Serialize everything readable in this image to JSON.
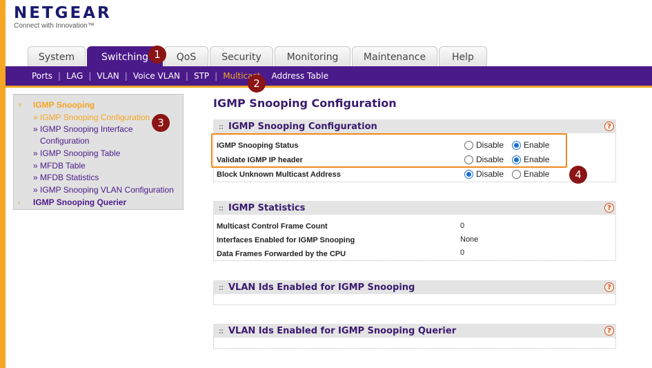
{
  "brand": {
    "name": "NETGEAR",
    "tagline": "Connect with Innovation™"
  },
  "tabs": [
    {
      "label": "System"
    },
    {
      "label": "Switching",
      "active": true
    },
    {
      "label": "QoS"
    },
    {
      "label": "Security"
    },
    {
      "label": "Monitoring"
    },
    {
      "label": "Maintenance"
    },
    {
      "label": "Help"
    }
  ],
  "subnav": [
    {
      "label": "Ports"
    },
    {
      "label": "LAG"
    },
    {
      "label": "VLAN"
    },
    {
      "label": "Voice VLAN"
    },
    {
      "label": "STP"
    },
    {
      "label": "Multicast",
      "active": true
    },
    {
      "label": "Address Table"
    }
  ],
  "sidebar": {
    "section1": "IGMP Snooping",
    "links": [
      "» IGMP Snooping Configuration",
      "» IGMP Snooping Interface",
      "Configuration",
      "» IGMP Snooping Table",
      "» MFDB Table",
      "» MFDB Statistics",
      "» IGMP Snooping VLAN Configuration"
    ],
    "section2": "IGMP Snooping Querier"
  },
  "page_title": "IGMP Snooping Configuration",
  "config_panel": {
    "title": "IGMP Snooping Configuration",
    "rows": [
      {
        "label": "IGMP Snooping Status",
        "selected": "Enable"
      },
      {
        "label": "Validate IGMP IP header",
        "selected": "Enable"
      },
      {
        "label": "Block Unknown Multicast Address",
        "selected": "Disable"
      }
    ],
    "option_disable": "Disable",
    "option_enable": "Enable"
  },
  "stats_panel": {
    "title": "IGMP Statistics",
    "rows": [
      {
        "label": "Multicast Control Frame Count",
        "value": "0"
      },
      {
        "label": "Interfaces Enabled for IGMP Snooping",
        "value": "None"
      },
      {
        "label": "Data Frames Forwarded by the CPU",
        "value": "0"
      }
    ]
  },
  "vlan_panel": {
    "title": "VLAN Ids Enabled for IGMP Snooping"
  },
  "vlan_querier_panel": {
    "title": "VLAN Ids Enabled for IGMP Snooping Querier"
  },
  "help_glyph": "?",
  "markers": [
    "1",
    "2",
    "3",
    "4"
  ],
  "colors": {
    "purple": "#4b1a8a",
    "orange": "#f5a623",
    "marker": "#8b1414"
  }
}
